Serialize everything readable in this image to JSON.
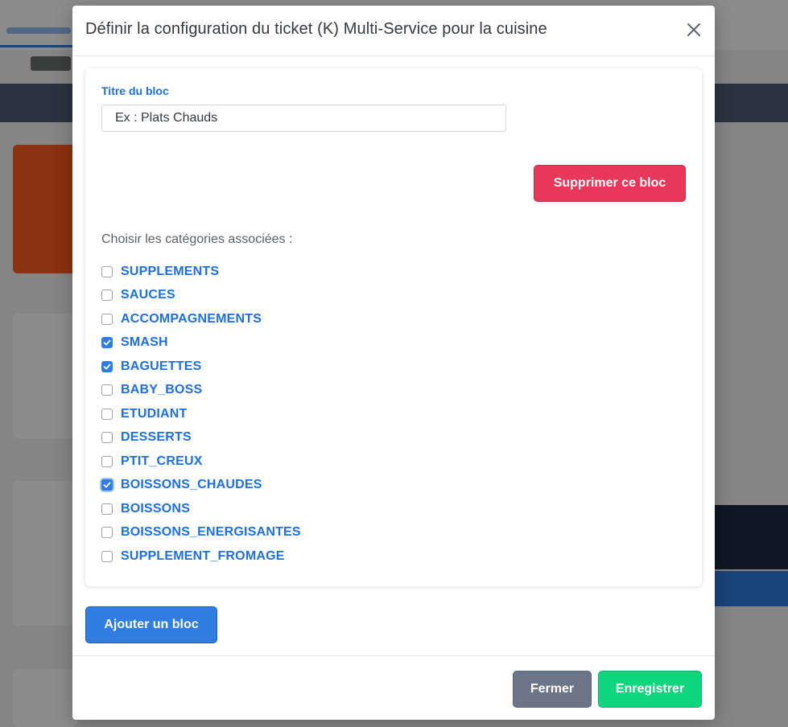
{
  "modal": {
    "title": "Définir la configuration du ticket (K) Multi-Service pour la cuisine"
  },
  "block": {
    "title_label": "Titre du bloc",
    "title_value": "Ex : Plats Chauds",
    "delete_label": "Supprimer ce bloc",
    "categories_label": "Choisir les catégories associées :",
    "categories": [
      {
        "name": "SUPPLEMENTS",
        "checked": false
      },
      {
        "name": "SAUCES",
        "checked": false
      },
      {
        "name": "ACCOMPAGNEMENTS",
        "checked": false
      },
      {
        "name": "SMASH",
        "checked": true
      },
      {
        "name": "BAGUETTES",
        "checked": true
      },
      {
        "name": "BABY_BOSS",
        "checked": false
      },
      {
        "name": "ETUDIANT",
        "checked": false
      },
      {
        "name": "DESSERTS",
        "checked": false
      },
      {
        "name": "PTIT_CREUX",
        "checked": false
      },
      {
        "name": "BOISSONS_CHAUDES",
        "checked": true,
        "focused": true
      },
      {
        "name": "BOISSONS",
        "checked": false
      },
      {
        "name": "BOISSONS_ENERGISANTES",
        "checked": false
      },
      {
        "name": "SUPPLEMENT_FROMAGE",
        "checked": false
      }
    ]
  },
  "actions": {
    "add_block": "Ajouter un bloc",
    "close": "Fermer",
    "save": "Enregistrer"
  },
  "colors": {
    "primary": "#2f7de1",
    "danger": "#e8385a",
    "secondary": "#6c7587",
    "success": "#0fd67c"
  }
}
